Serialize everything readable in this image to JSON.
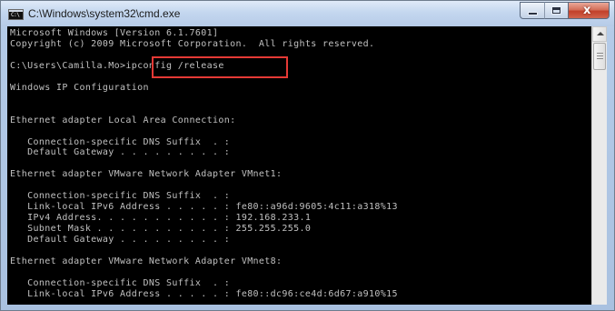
{
  "window": {
    "title": "C:\\Windows\\system32\\cmd.exe",
    "icon_text": "C:\\",
    "controls": [
      "minimize",
      "maximize",
      "close"
    ],
    "close_glyph": "x",
    "colors": {
      "console_bg": "#000000",
      "console_text": "#c0c0c0",
      "highlight": "#e53935"
    }
  },
  "console": {
    "lines": [
      "Microsoft Windows [Version 6.1.7601]",
      "Copyright (c) 2009 Microsoft Corporation.  All rights reserved.",
      "",
      "C:\\Users\\Camilla.Mo>ipconfig /release",
      "",
      "Windows IP Configuration",
      "",
      "",
      "Ethernet adapter Local Area Connection:",
      "",
      "   Connection-specific DNS Suffix  . :",
      "   Default Gateway . . . . . . . . . :",
      "",
      "Ethernet adapter VMware Network Adapter VMnet1:",
      "",
      "   Connection-specific DNS Suffix  . :",
      "   Link-local IPv6 Address . . . . . : fe80::a96d:9605:4c11:a318%13",
      "   IPv4 Address. . . . . . . . . . . : 192.168.233.1",
      "   Subnet Mask . . . . . . . . . . . : 255.255.255.0",
      "   Default Gateway . . . . . . . . . :",
      "",
      "Ethernet adapter VMware Network Adapter VMnet8:",
      "",
      "   Connection-specific DNS Suffix  . :",
      "   Link-local IPv6 Address . . . . . : fe80::dc96:ce4d:6d67:a910%15"
    ],
    "highlighted_command": "ipconfig /release"
  }
}
